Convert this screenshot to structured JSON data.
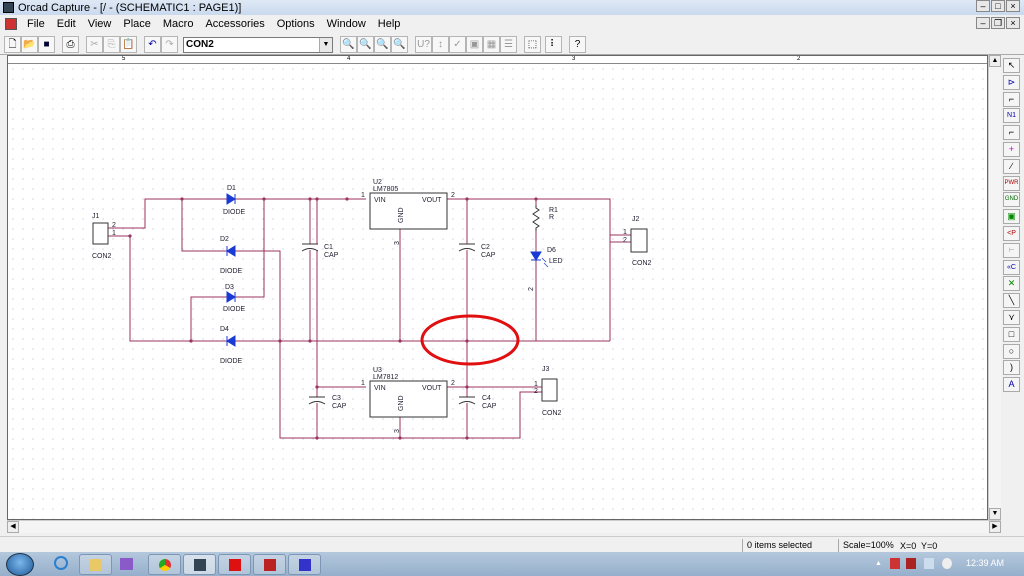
{
  "window": {
    "title": "Orcad Capture - [/ - (SCHEMATIC1 : PAGE1)]"
  },
  "menu": [
    "File",
    "Edit",
    "View",
    "Place",
    "Macro",
    "Accessories",
    "Options",
    "Window",
    "Help"
  ],
  "toolbar": {
    "part_selector": "CON2"
  },
  "ruler": [
    "5",
    "4",
    "3",
    "2"
  ],
  "schematic": {
    "J1": {
      "ref": "J1",
      "value": "CON2",
      "pin1": "1",
      "pin2": "2"
    },
    "J2": {
      "ref": "J2",
      "value": "CON2",
      "pin1": "1",
      "pin2": "2"
    },
    "J3": {
      "ref": "J3",
      "value": "CON2",
      "pin1": "1",
      "pin2": "2"
    },
    "D1": {
      "ref": "D1",
      "value": "DIODE"
    },
    "D2": {
      "ref": "D2",
      "value": "DIODE"
    },
    "D3": {
      "ref": "D3",
      "value": "DIODE"
    },
    "D4": {
      "ref": "D4",
      "value": "DIODE"
    },
    "C1": {
      "ref": "C1",
      "value": "CAP"
    },
    "C2": {
      "ref": "C2",
      "value": "CAP"
    },
    "C3": {
      "ref": "C3",
      "value": "CAP"
    },
    "C4": {
      "ref": "C4",
      "value": "CAP"
    },
    "U2": {
      "ref": "U2",
      "value": "LM7805",
      "vin": "VIN",
      "vout": "VOUT",
      "gnd": "GND",
      "p1": "1",
      "p2": "2",
      "p3": "3"
    },
    "U3": {
      "ref": "U3",
      "value": "LM7812",
      "vin": "VIN",
      "vout": "VOUT",
      "gnd": "GND",
      "p1": "1",
      "p2": "2",
      "p3": "3"
    },
    "R1": {
      "ref": "R1",
      "value": "R"
    },
    "D6": {
      "ref": "D6",
      "value": "LED",
      "pin2": "2"
    }
  },
  "palette": [
    "select",
    "place-part",
    "wire",
    "net-alias",
    "bus",
    "junction",
    "bus-entry",
    "power",
    "ground",
    "hierarchical-block",
    "hier-port",
    "hier-pin",
    "off-page",
    "no-connect",
    "line",
    "polyline",
    "rectangle",
    "ellipse",
    "arc",
    "text"
  ],
  "status": {
    "selection": "0 items selected",
    "scale": "Scale=100%",
    "x": "X=0",
    "y": "Y=0"
  },
  "taskbar": {
    "clock": "12:39 AM"
  },
  "colors": {
    "wire": "#99335f",
    "diode": "#1a3ad6",
    "annotation": "#e01010"
  }
}
